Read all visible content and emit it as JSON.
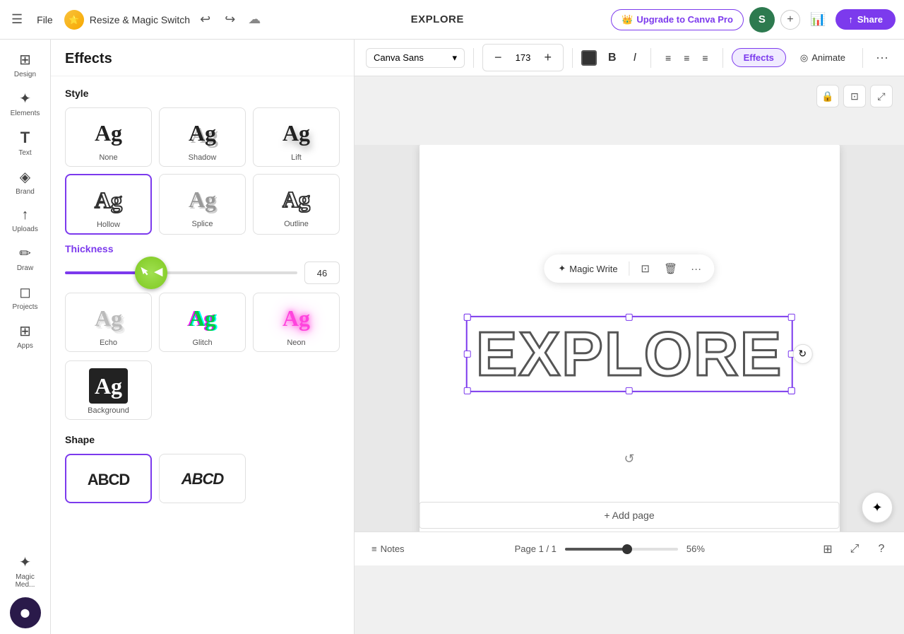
{
  "topbar": {
    "menu_icon": "☰",
    "file_label": "File",
    "logo_emoji": "⭐",
    "title": "Resize & Magic Switch",
    "undo_icon": "↩",
    "redo_icon": "↪",
    "cloud_icon": "☁",
    "center_text": "EXPLORE",
    "upgrade_label": "Upgrade to Canva Pro",
    "upgrade_icon": "👑",
    "avatar_letter": "S",
    "plus_icon": "+",
    "chart_icon": "📊",
    "share_icon": "↑",
    "share_label": "Share"
  },
  "sidebar": {
    "items": [
      {
        "id": "design",
        "icon": "⊞",
        "label": "Design"
      },
      {
        "id": "elements",
        "icon": "✦",
        "label": "Elements"
      },
      {
        "id": "text",
        "icon": "T",
        "label": "Text"
      },
      {
        "id": "brand",
        "icon": "◈",
        "label": "Brand"
      },
      {
        "id": "uploads",
        "icon": "↑",
        "label": "Uploads"
      },
      {
        "id": "draw",
        "icon": "✏",
        "label": "Draw"
      },
      {
        "id": "projects",
        "icon": "◻",
        "label": "Projects"
      },
      {
        "id": "apps",
        "icon": "⊞",
        "label": "Apps"
      },
      {
        "id": "magic",
        "icon": "✦",
        "label": "Magic Med..."
      }
    ]
  },
  "effects_panel": {
    "header": "Effects",
    "style_section_label": "Style",
    "styles": [
      {
        "id": "none",
        "name": "None",
        "active": false
      },
      {
        "id": "shadow",
        "name": "Shadow",
        "active": false
      },
      {
        "id": "lift",
        "name": "Lift",
        "active": false
      },
      {
        "id": "hollow",
        "name": "Hollow",
        "active": true
      },
      {
        "id": "splice",
        "name": "Splice",
        "active": false
      },
      {
        "id": "outline",
        "name": "Outline",
        "active": false
      },
      {
        "id": "echo",
        "name": "Echo",
        "active": false
      },
      {
        "id": "glitch",
        "name": "Glitch",
        "active": false
      },
      {
        "id": "neon",
        "name": "Neon",
        "active": false
      },
      {
        "id": "background",
        "name": "Background",
        "active": false
      }
    ],
    "thickness_label": "Thickness",
    "thickness_value": "46",
    "shape_section_label": "Shape",
    "shapes": [
      {
        "id": "normal",
        "name": "",
        "active": true,
        "text": "ABCD"
      },
      {
        "id": "italic",
        "name": "",
        "active": false,
        "text": "ABCD"
      }
    ]
  },
  "toolbar": {
    "font_family": "Canva Sans",
    "font_size": "173",
    "minus_icon": "−",
    "plus_icon": "+",
    "color_label": "text color",
    "bold_label": "B",
    "italic_label": "I",
    "align_left": "≡",
    "align_center": "≡",
    "align_right": "≡",
    "effects_label": "Effects",
    "animate_icon": "◎",
    "animate_label": "Animate",
    "more_label": "···"
  },
  "canvas": {
    "explore_text": "EXPLORE",
    "magic_write_label": "Magic Write",
    "magic_write_icon": "✦",
    "copy_icon": "⊡",
    "delete_icon": "🗑",
    "more_icon": "···",
    "rotate_icon": "↻",
    "add_page_label": "+ Add page",
    "show_pages_icon": "⊟",
    "lock_icon": "🔒",
    "duplicate_icon": "⊡",
    "expand_icon": "⤢"
  },
  "bottom_bar": {
    "notes_icon": "≡",
    "notes_label": "Notes",
    "page_info": "Page 1 / 1",
    "zoom_percent": "56%",
    "grid_icon": "⊞",
    "expand_icon": "⤢",
    "help_icon": "?"
  },
  "colors": {
    "accent": "#7c3aed",
    "canvas_border": "#7c3aed",
    "green_thumb": "#8ec620",
    "text_stroke": "#555555"
  }
}
